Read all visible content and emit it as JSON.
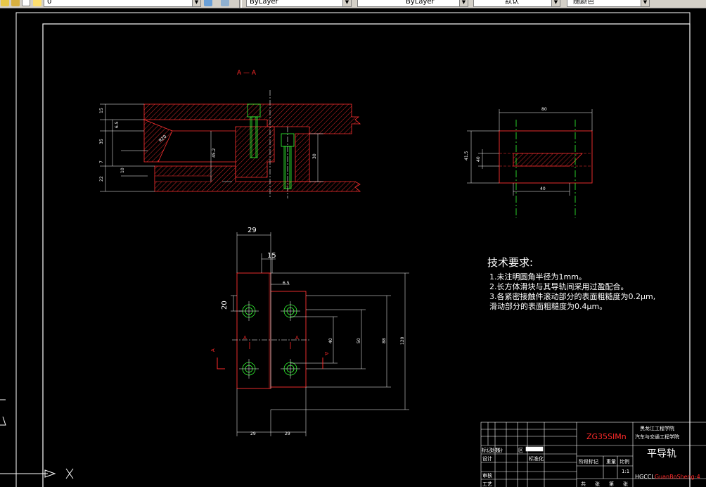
{
  "toolbar": {
    "layer_value": "0",
    "color_value": "ByLayer",
    "linetype_value": "ByLayer",
    "lineweight_value": "默认",
    "plotstyle_value": "随颜色"
  },
  "drawing": {
    "section_label": "A — A",
    "dims_top": {
      "d15": "15",
      "d65": "6.5",
      "d35": "35",
      "d7": "7",
      "d10": "10",
      "d22": "22",
      "d452": "45.2",
      "d30": "30",
      "d20": "R20"
    },
    "dims_side": {
      "d80": "80",
      "d415": "41.5",
      "d40v": "40",
      "d40h": "40"
    },
    "dims_plan": {
      "d29": "29",
      "d15": "15",
      "d65": "6.5",
      "d20": "20",
      "d40": "40",
      "d50": "50",
      "d88": "88",
      "d120": "120",
      "d29b": "29",
      "d29c": "29",
      "a1": "A",
      "a2": "A",
      "a3": "A",
      "a4": "A"
    },
    "tech": {
      "title": "技术要求:",
      "lines": [
        "1.未注明圆角半径为1mm。",
        "2.长方体滑块与其导轨间采用过盈配合。",
        "3.各紧密接触件滚动部分的表面粗糙度为0.2μm,",
        "滑动部分的表面粗糙度为0.4μm。"
      ]
    },
    "title_block": {
      "material": "ZG35SIMn",
      "school_1": "黑龙江工程学院",
      "school_2": "汽车与交通工程学院",
      "part_name": "平导轨",
      "code_prefix": "HGCCL",
      "code_suffix": "GuanBoSheng-4",
      "scale": "1:1",
      "row_labels": [
        "标记",
        "处数",
        "分",
        "区",
        "设计",
        "标准化",
        "审核",
        "工艺",
        "阶段标记",
        "重量",
        "比例",
        "共",
        "张",
        "第",
        "张"
      ]
    }
  }
}
